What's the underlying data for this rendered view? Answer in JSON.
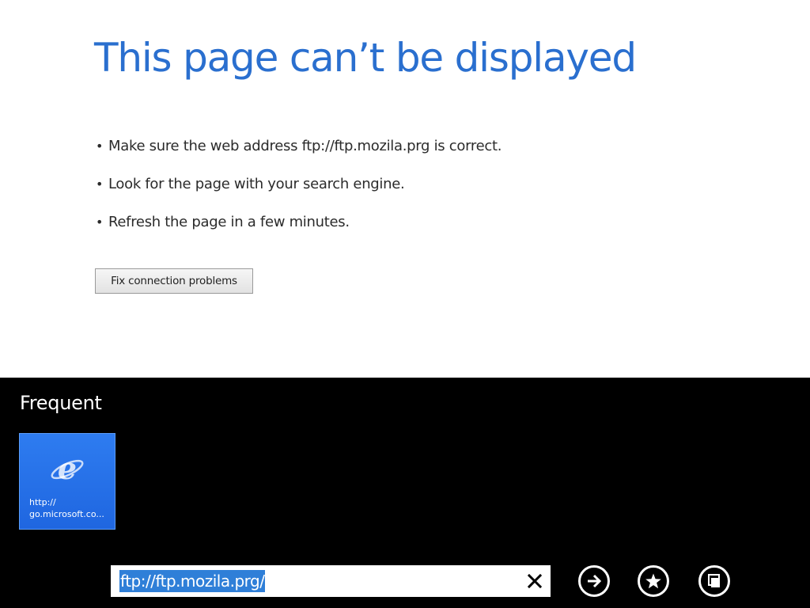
{
  "error": {
    "title": "This page can’t be displayed",
    "tips": [
      "Make sure the web address ftp://ftp.mozila.prg is correct.",
      "Look for the page with your search engine.",
      "Refresh the page in a few minutes."
    ],
    "fix_button_label": "Fix connection problems"
  },
  "app_bar": {
    "frequent_heading": "Frequent",
    "tiles": [
      {
        "label": "http://\ngo.microsoft.co...",
        "icon": "internet-explorer-icon",
        "color": "#2a75ee"
      }
    ],
    "address": {
      "value": "ftp://ftp.mozila.prg/",
      "selected": true
    },
    "buttons": {
      "clear": "close-icon",
      "go": "arrow-right-icon",
      "favorites": "star-icon",
      "tabs": "tabs-icon"
    }
  },
  "colors": {
    "title_blue": "#2a6fcf",
    "selection_blue": "#2f7fd8",
    "app_bar_bg": "#000000"
  }
}
